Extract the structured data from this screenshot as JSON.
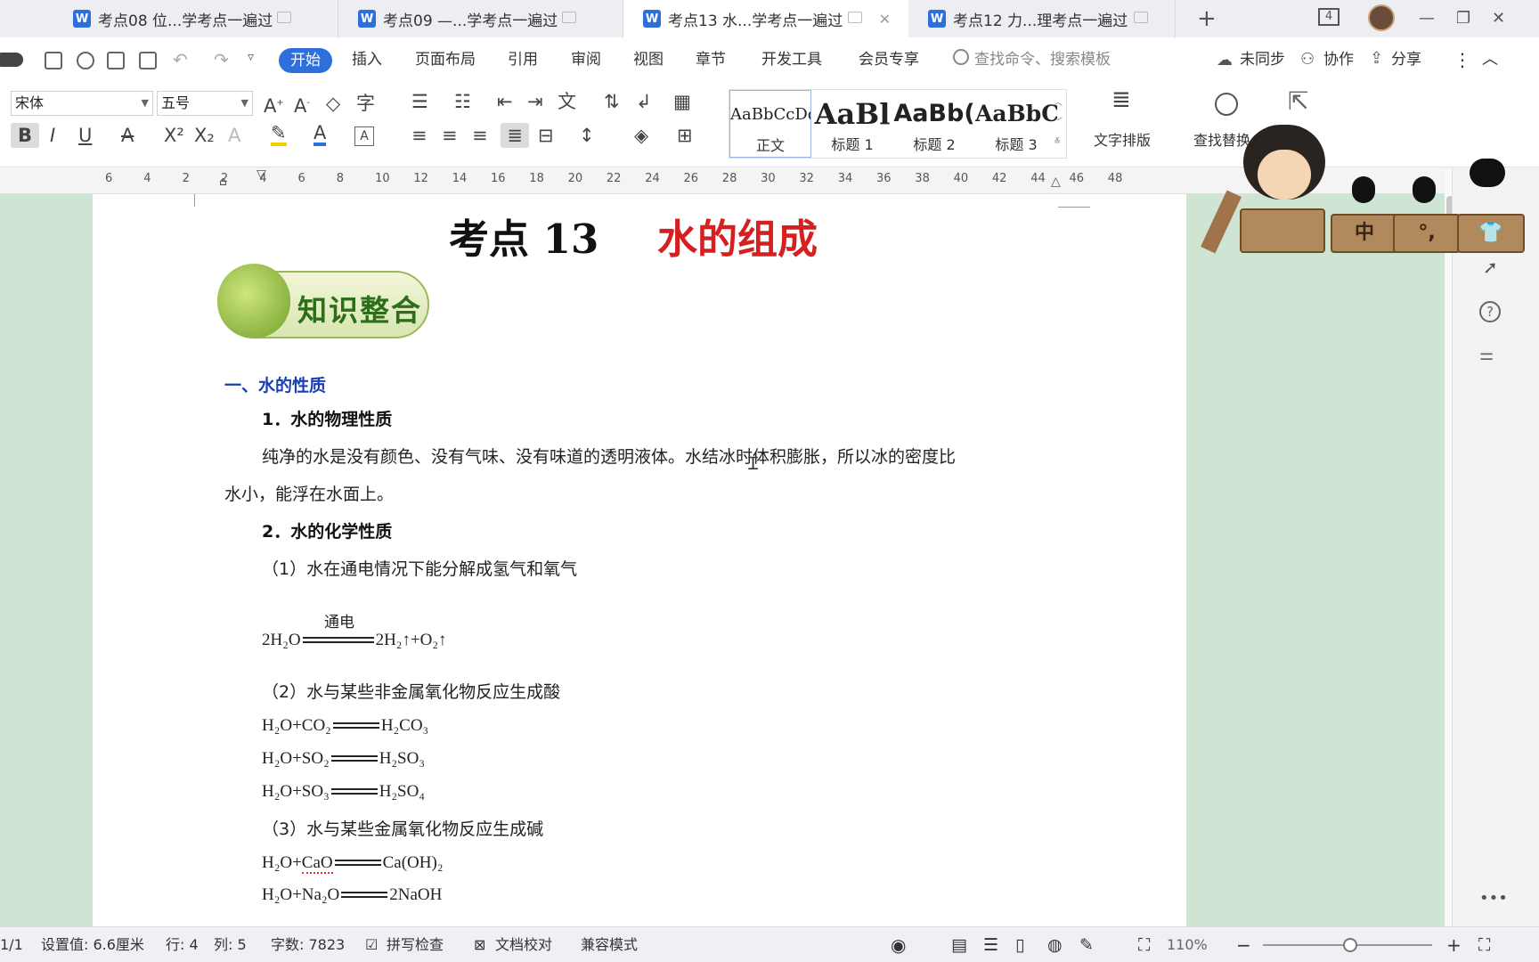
{
  "tabs": [
    {
      "label": "考点08 位...学考点一遍过",
      "active": false
    },
    {
      "label": "考点09 —...学考点一遍过",
      "active": false
    },
    {
      "label": "考点13 水...学考点一遍过",
      "active": true
    },
    {
      "label": "考点12 力...理考点一遍过",
      "active": false
    }
  ],
  "window": {
    "new_tab": "+",
    "tab_count": "4",
    "minimize": "—",
    "restore": "❐",
    "close": "✕"
  },
  "menu": {
    "items": [
      "开始",
      "插入",
      "页面布局",
      "引用",
      "审阅",
      "视图",
      "章节",
      "开发工具",
      "会员专享"
    ],
    "search_placeholder": "查找命令、搜索模板",
    "sync": "未同步",
    "collab": "协作",
    "share": "分享"
  },
  "ribbon": {
    "font_name": "宋体",
    "font_size": "五号",
    "styles": [
      {
        "preview": "AaBbCcDd",
        "label": "正文"
      },
      {
        "preview": "AaBl",
        "label": "标题 1"
      },
      {
        "preview": "AaBb(",
        "label": "标题 2"
      },
      {
        "preview": "AaBbC",
        "label": "标题 3"
      }
    ],
    "text_layout": "文字排版",
    "find_replace": "查找替换"
  },
  "ruler": [
    "6",
    "4",
    "2",
    "2",
    "4",
    "6",
    "8",
    "10",
    "12",
    "14",
    "16",
    "18",
    "20",
    "22",
    "24",
    "26",
    "28",
    "30",
    "32",
    "34",
    "36",
    "38",
    "40",
    "42",
    "44",
    "46",
    "48"
  ],
  "doc": {
    "title_prefix": "考点 13",
    "title_main": "水的组成",
    "banner": "知识整合",
    "section1": "一、水的性质",
    "sub1": "1．水的物理性质",
    "para1_line1": "纯净的水是没有颜色、没有气味、没有味道的透明液体。水结冰时体积膨胀，所以冰的密度比",
    "para1_line2": "水小，能浮在水面上。",
    "sub2": "2．水的化学性质",
    "item1": "（1）水在通电情况下能分解成氢气和氧气",
    "eq1_condition": "通电",
    "eq1_left": "2H₂O",
    "eq1_right": "2H₂↑+O₂↑",
    "item2": "（2）水与某些非金属氧化物反应生成酸",
    "eq2_left": "H₂O+CO₂",
    "eq2_right": "H₂CO₃",
    "eq3_left": "H₂O+SO₂",
    "eq3_right": "H₂SO₃",
    "eq4_left": "H₂O+SO₃",
    "eq4_right": "H₂SO₄",
    "item3": "（3）水与某些金属氧化物反应生成碱",
    "eq5_left_a": "H₂O+",
    "eq5_left_b": "CaO",
    "eq5_right": "Ca(OH)₂",
    "eq6_left": "H₂O+Na₂O",
    "eq6_right": "2NaOH"
  },
  "mascot": {
    "keys": [
      "中",
      "°,"
    ]
  },
  "status": {
    "page": "1/1",
    "setting": "设置值: 6.6厘米",
    "row": "行: 4",
    "col": "列: 5",
    "words": "字数: 7823",
    "spell": "拼写检查",
    "proof": "文档校对",
    "compat": "兼容模式",
    "zoom": "110%"
  },
  "colors": {
    "accent": "#2f6fdb",
    "title_red": "#d42020",
    "heading_blue": "#1a3fb5",
    "page_bg": "#cfe5d3"
  }
}
